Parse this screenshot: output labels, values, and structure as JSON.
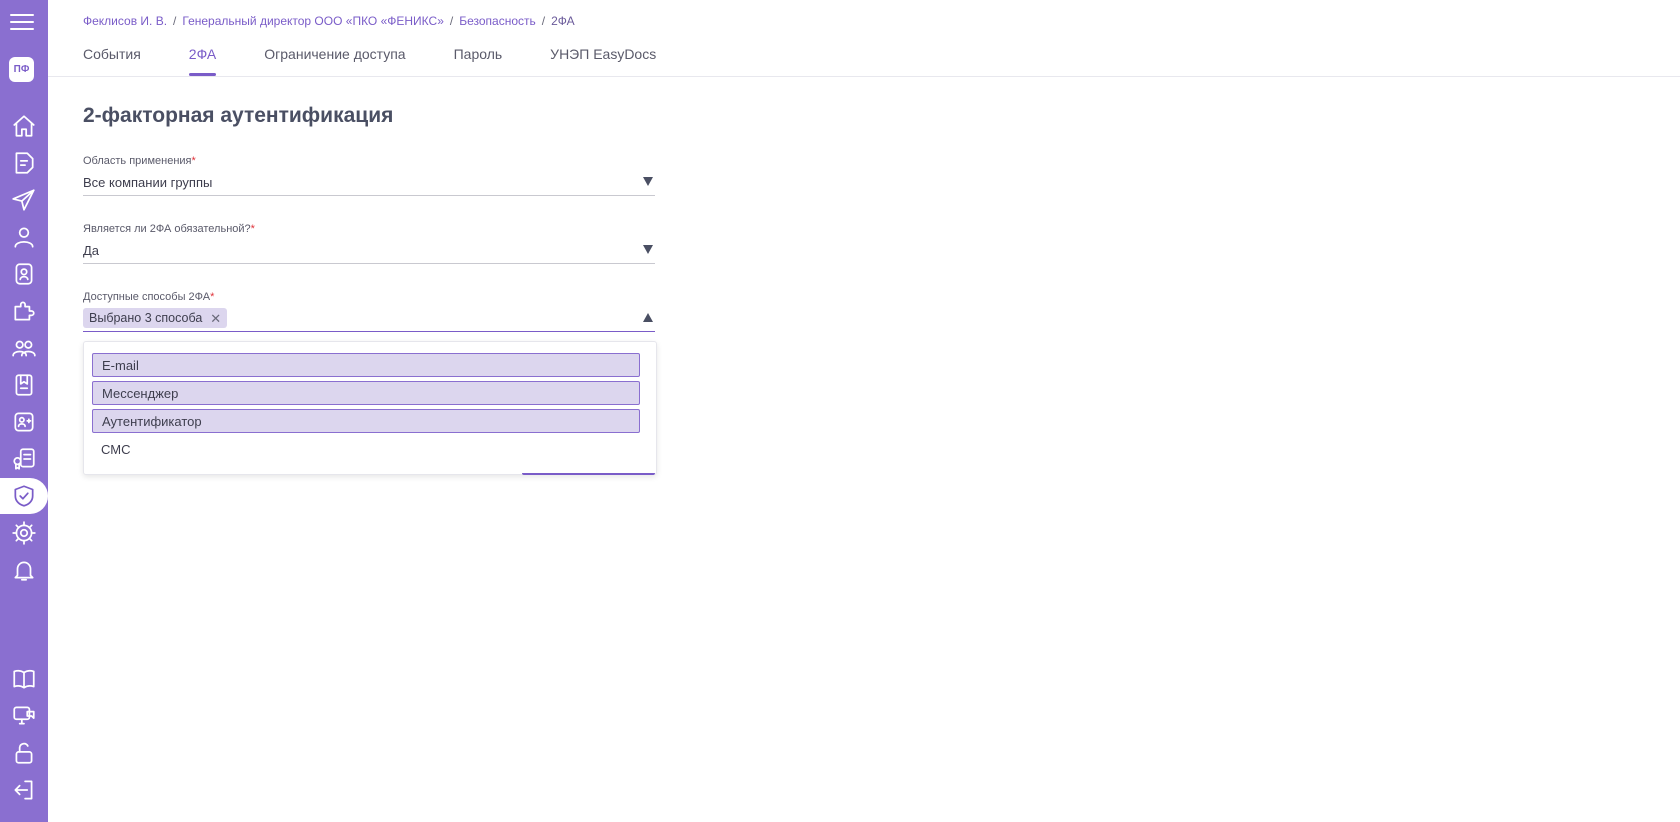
{
  "sidebar": {
    "avatar_initials": "ПФ",
    "accent_color": "#8a6fd0",
    "icons": [
      "menu-icon",
      "home-icon",
      "document-icon",
      "paper-plane-icon",
      "user-icon",
      "badge-icon",
      "puzzle-icon",
      "users-group-icon",
      "book-badge-icon",
      "contact-card-icon",
      "certificate-icon",
      "shield-check-icon",
      "gear-icon",
      "bell-icon",
      "open-book-icon",
      "monitor-chat-icon",
      "unlock-icon",
      "logout-icon"
    ]
  },
  "breadcrumb": {
    "items": [
      "Феклисов И. В.",
      "Генеральный директор ООО «ПКО «ФЕНИКС»",
      "Безопасность",
      "2ФА"
    ],
    "separator": "/"
  },
  "tabs": [
    {
      "label": "События"
    },
    {
      "label": "2ФА",
      "active": true
    },
    {
      "label": "Ограничение доступа"
    },
    {
      "label": "Пароль"
    },
    {
      "label": "УНЭП EasyDocs"
    }
  ],
  "page": {
    "title": "2-факторная аутентификация"
  },
  "form": {
    "scope": {
      "label": "Область применения",
      "required_mark": "*",
      "value": "Все компании группы"
    },
    "mandatory": {
      "label": "Является ли 2ФА обязательной?",
      "required_mark": "*",
      "value": "Да"
    },
    "methods": {
      "label": "Доступные способы 2ФА",
      "required_mark": "*",
      "chip": "Выбрано 3 способа",
      "chip_close": "✕",
      "options": [
        {
          "label": "E-mail",
          "selected": true
        },
        {
          "label": "Мессенджер",
          "selected": true
        },
        {
          "label": "Аутентификатор",
          "selected": true
        },
        {
          "label": "СМС",
          "selected": false
        }
      ]
    }
  }
}
